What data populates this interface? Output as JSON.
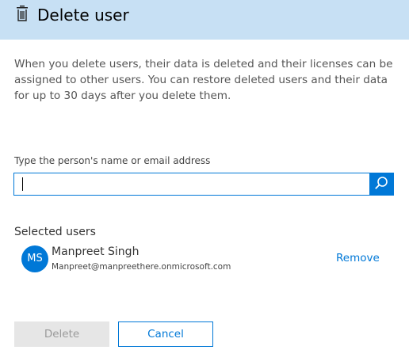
{
  "header": {
    "title": "Delete user",
    "icon": "trash-icon",
    "background": "#c7e0f4"
  },
  "description": "When you delete users, their data is deleted and their licenses can be assigned to other users. You can restore deleted users and their data for up to 30 days after you delete them.",
  "search": {
    "label": "Type the person's name or email address",
    "value": "",
    "icon": "search-icon"
  },
  "selected_users": {
    "title": "Selected users",
    "items": [
      {
        "initials": "MS",
        "name": "Manpreet Singh",
        "email": "Manpreet@manpreethere.onmicrosoft.com",
        "remove_label": "Remove"
      }
    ]
  },
  "actions": {
    "delete_label": "Delete",
    "cancel_label": "Cancel"
  },
  "colors": {
    "accent": "#0078d7",
    "disabled_bg": "#e6e6e6"
  }
}
